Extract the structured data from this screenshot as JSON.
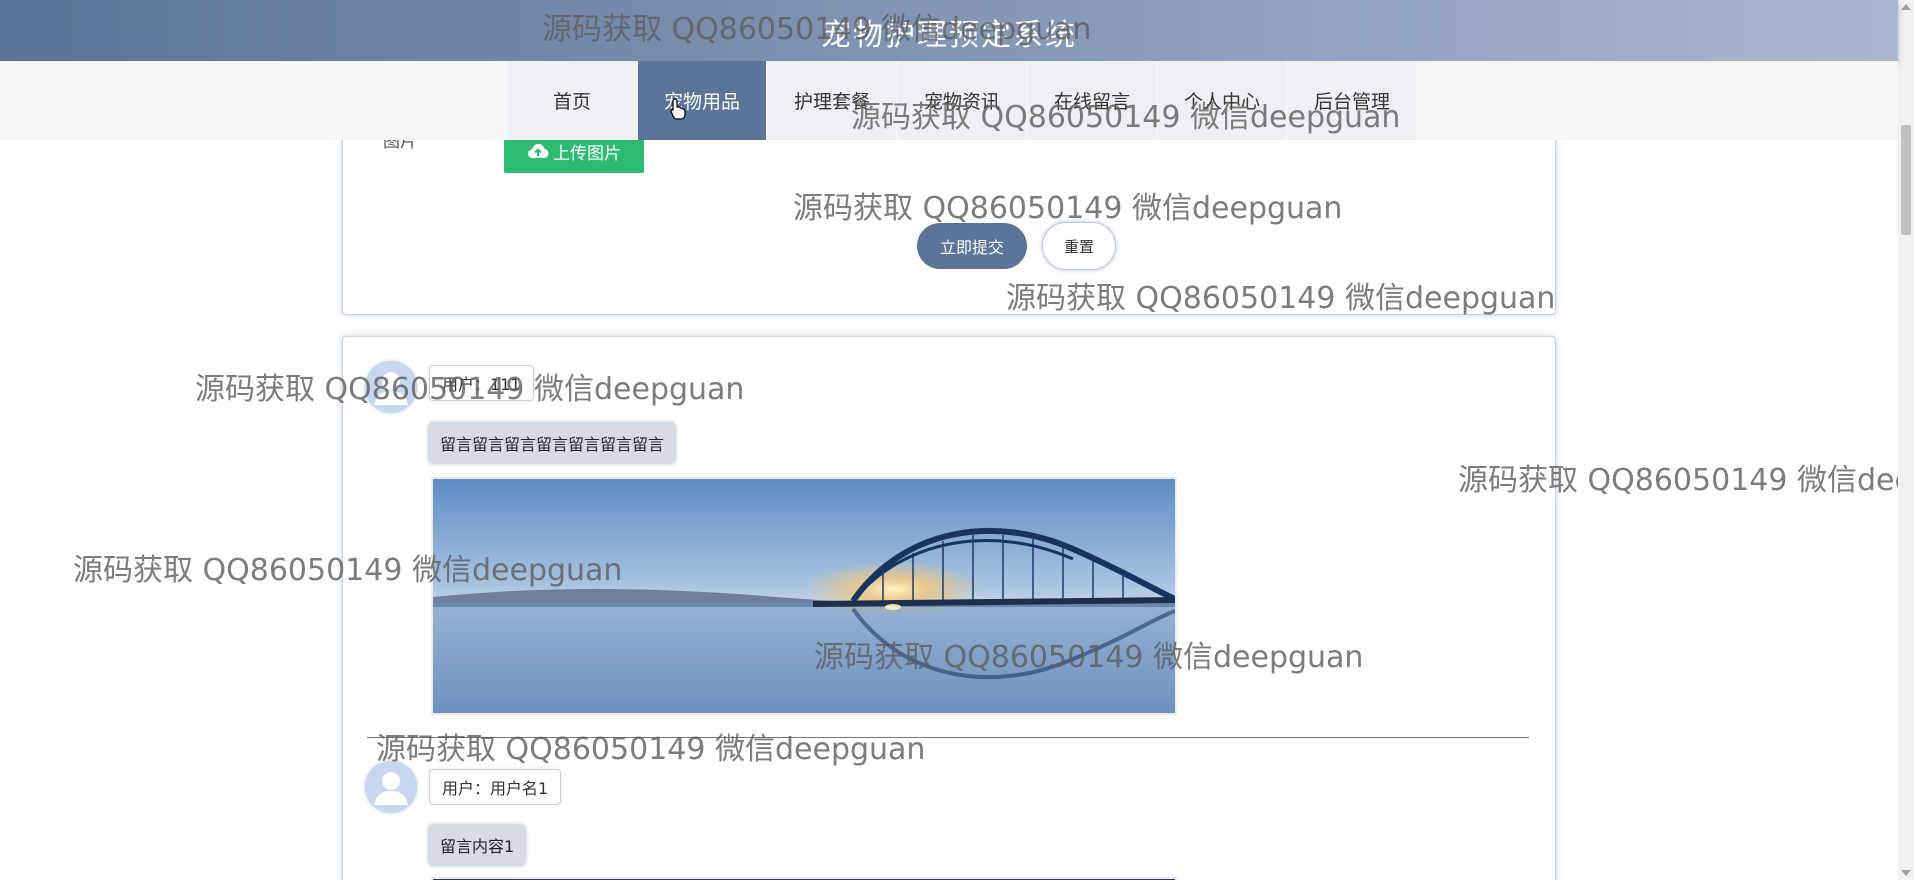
{
  "site": {
    "title": "宠物护理预定系统"
  },
  "nav": {
    "items": [
      {
        "label": "首页",
        "active": false
      },
      {
        "label": "宠物用品",
        "active": true
      },
      {
        "label": "护理套餐",
        "active": false
      },
      {
        "label": "宠物资讯",
        "active": false
      },
      {
        "label": "在线留言",
        "active": false
      },
      {
        "label": "个人中心",
        "active": false
      },
      {
        "label": "后台管理",
        "active": false
      }
    ]
  },
  "form": {
    "image_label": "图片",
    "upload_label": "上传图片",
    "submit_label": "立即提交",
    "reset_label": "重置"
  },
  "messages": [
    {
      "user": "用户：111",
      "content": "留言留言留言留言留言留言留言"
    },
    {
      "user": "用户：用户名1",
      "content": "留言内容1"
    }
  ],
  "watermark_text": "源码获取 QQ86050149 微信deepguan",
  "colors": {
    "accent": "#5b7498",
    "upload_green": "#2dbb72",
    "header_start": "#5a7396",
    "header_end": "#a9b6cf"
  },
  "icons": {
    "upload": "cloud-upload-icon",
    "avatar": "user-avatar-icon",
    "cursor": "hand-pointer-icon"
  }
}
